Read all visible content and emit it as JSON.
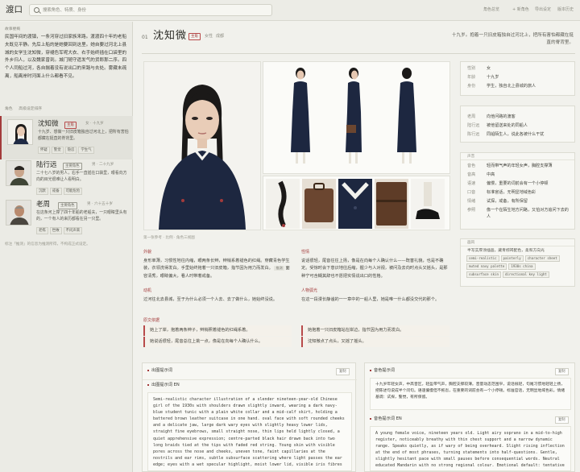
{
  "app": {
    "title": "渡口"
  },
  "search": {
    "placeholder": "搜索角色、特质、身份"
  },
  "top_links": [
    "角色总览",
    "+ 新角色",
    "导出设定",
    "版本历史"
  ],
  "sidebar": {
    "section_label": "故事梗概",
    "intro": "民国年间的渡镇，一条河穿过旧家族来路。渡渡四十年的老船夫既见平静。先后上船的是她要回到这里。她自要过河北上县城的女学生沈知微，穿褪色军呢大衣、右手始终插在口袋里的外乡归人，以及魏家曾到。城门随守遗发气的货郎那二序。四个人同船过河，各自揣着没有说出口的来路与去处。雾藏未疏离，船离岸时河面上什么都看不见。",
    "tabs": [
      "角色",
      "高级设定排序"
    ],
    "cards": [
      {
        "name": "沈知微",
        "badge": "主角",
        "age": "女 · 十九岁",
        "desc": "十九岁、想做一只旧皮箱独自过河北上，把所有害怕都藏在挺直的脊背里。",
        "tags": [
          "怀疑",
          "警觉",
          "隐忍",
          "学生气"
        ]
      },
      {
        "name": "陆行远",
        "badge": "主要角色",
        "age": "男 · 二十九岁",
        "desc": "二十七八岁的男人，右手一直插在口袋里，眼看向方向的目光很难让人看明白。",
        "tags": [
          "沉默",
          "戒备",
          "可能危险"
        ]
      },
      {
        "name": "老周",
        "badge": "主要角色",
        "age": "男 · 六十五十岁",
        "desc": "在这条河上撑了四十年船的老船夫，一只眼睛里头有的，一个有人的来历都看在另一只里。",
        "tags": [
          "老练",
          "世故",
          "不问声来"
        ]
      }
    ],
    "footer": "标注「推测」的信息为推测所得，不构成正式设定。"
  },
  "main": {
    "number": "01",
    "name": "沈知微",
    "role_badge": "主角",
    "meta": [
      "女性",
      "成都"
    ],
    "quote": "十九岁。抱着一只旧皮箱独自过河北上，把所有害怕都藏在挺直的脊背里。",
    "caption": "第一张参考 · 比例 · 角色三视图",
    "appearance_title": "外貌",
    "appearance": "身形单薄，习惯性地往内缩，眼两条长辫，辫梢系着褪色的红绳。穿藏青色学生装，衣领洗得发白。手里始终拖着一只旧皮箱，指节因为用力而发白。",
    "appearance_tag": "推测",
    "appearance_tail": "面容清秀，眼睛偏大，看人时带着戒备。",
    "motive_title": "动机",
    "motive": "过河往北去县城，至于为什么必须一个人去、去了做什么，她始终没说。",
    "voice_title": "性情",
    "voice": "说话很轻，尾音往往上扬，像是在向每个人确认什么——既害礼貌，也是不确定。受惊时会下意识地往后缩，握少与人对视，被问及去向时点头又摇头，是那种宁可含糊其辞也不愿把实情说出口的性格。",
    "inner_title": "人物弧光",
    "inner": "在这一段漫长静谧的一一章中的一船人里，她是唯一什么都没交代的那个。",
    "quotes_title": "原文依据",
    "quotes_left": [
      "她上了岸，抱着两条辫子，辫梢照着褪色的红绳系着。",
      "她说话很轻，尾音总往上挑一点，像是在向每个人确认什么。"
    ],
    "quotes_right": [
      "她抱着一只旧皮箱站在岸边，指节因为用力而发白。",
      "沈知微点了点头，又摇了摇头。"
    ]
  },
  "side": {
    "basic": [
      {
        "k": "性别",
        "v": "女"
      },
      {
        "k": "年龄",
        "v": "十九岁"
      },
      {
        "k": "身份",
        "v": "学生，独自北上县城的旅人"
      }
    ],
    "relations": [
      {
        "k": "老周",
        "v": "向他问路的渡客"
      },
      {
        "k": "陆行远",
        "v": "被他留送来处的同船人"
      },
      {
        "k": "陈行远",
        "v": "同船陌生人，说此各被什么干扰"
      }
    ],
    "voice_head": "声音",
    "voice": [
      {
        "k": "音色",
        "v": "轻而带气声的年轻女声，胸腔支撑薄"
      },
      {
        "k": "音高",
        "v": "中高"
      },
      {
        "k": "语速",
        "v": "偏慢，重要的词前会有一个小停顿"
      },
      {
        "k": "口音",
        "v": "标准官话，无明显地域色彩"
      },
      {
        "k": "情绪",
        "v": "试探，戒备，有所保留"
      },
      {
        "k": "参照",
        "v": "像一个在陌生地方问路，又怕对方追问下去的人"
      }
    ],
    "style_head": "画风",
    "style_note": "半写实厚涂插画，藏青棕褐配色，柔和方向光",
    "style_chips": [
      "semi-realistic",
      "painterly",
      "character sheet",
      "muted navy palette",
      "1930s china",
      "subsurface skin",
      "directional key light"
    ]
  },
  "prompts": {
    "image_title": "出图提示词",
    "image_en_title": "出图提示词 EN",
    "copy": "复制",
    "image_en": "Semi-realistic character illustration of a slender nineteen-year-old Chinese girl of the 1930s with shoulders drawn slightly inward, wearing a dark navy-blue student tunic with a plain white collar and a mid-calf skirt, holding a battered brown leather suitcase in one hand. oval face with soft rounded cheeks and a delicate jaw, large dark wary eyes with slightly heavy lower lids, straight fine eyebrows, small straight nose, thin lips held lightly closed, a quiet apprehensive expression; centre-parted black hair drawn back into two long braids tied at the tips with faded red string. Young skin with visible pores across the nose and cheeks, uneven tone, faint capillaries at the nostrils and ear rims, subtle subsurface scattering where light passes the ear edge; eyes with a wet specular highlight, moist lower lid, visible iris fibres",
    "voice_title": "音色提示词",
    "voice_zh": "十九岁年轻女声，中高音区，轻盈带气声，胸腔支撑较薄。音量动态范围窄，说话很轻，句尾习惯地轻轻上扬，把陈述句说成半个问句。语速偏慢但不拖沓，在重要的词前会有一个小停顿。标准官话，无明显地域色彩。情绪基调：试探，警觉，有所保留。",
    "voice_en_title": "音色提示词 EN",
    "voice_en": "A young female voice, nineteen years old. Light airy soprano in a mid-to-high register, noticeably breathy with thin chest support and a narrow dynamic range. Speaks quietly, as if wary of being overheard. Slight rising inflection at the end of most phrases, turning statements into half-questions. Gentle, slightly hesitant pace with small pauses before consequential words. Neutral educated Mandarin with no strong regional colour. Emotional default: tentative"
  }
}
